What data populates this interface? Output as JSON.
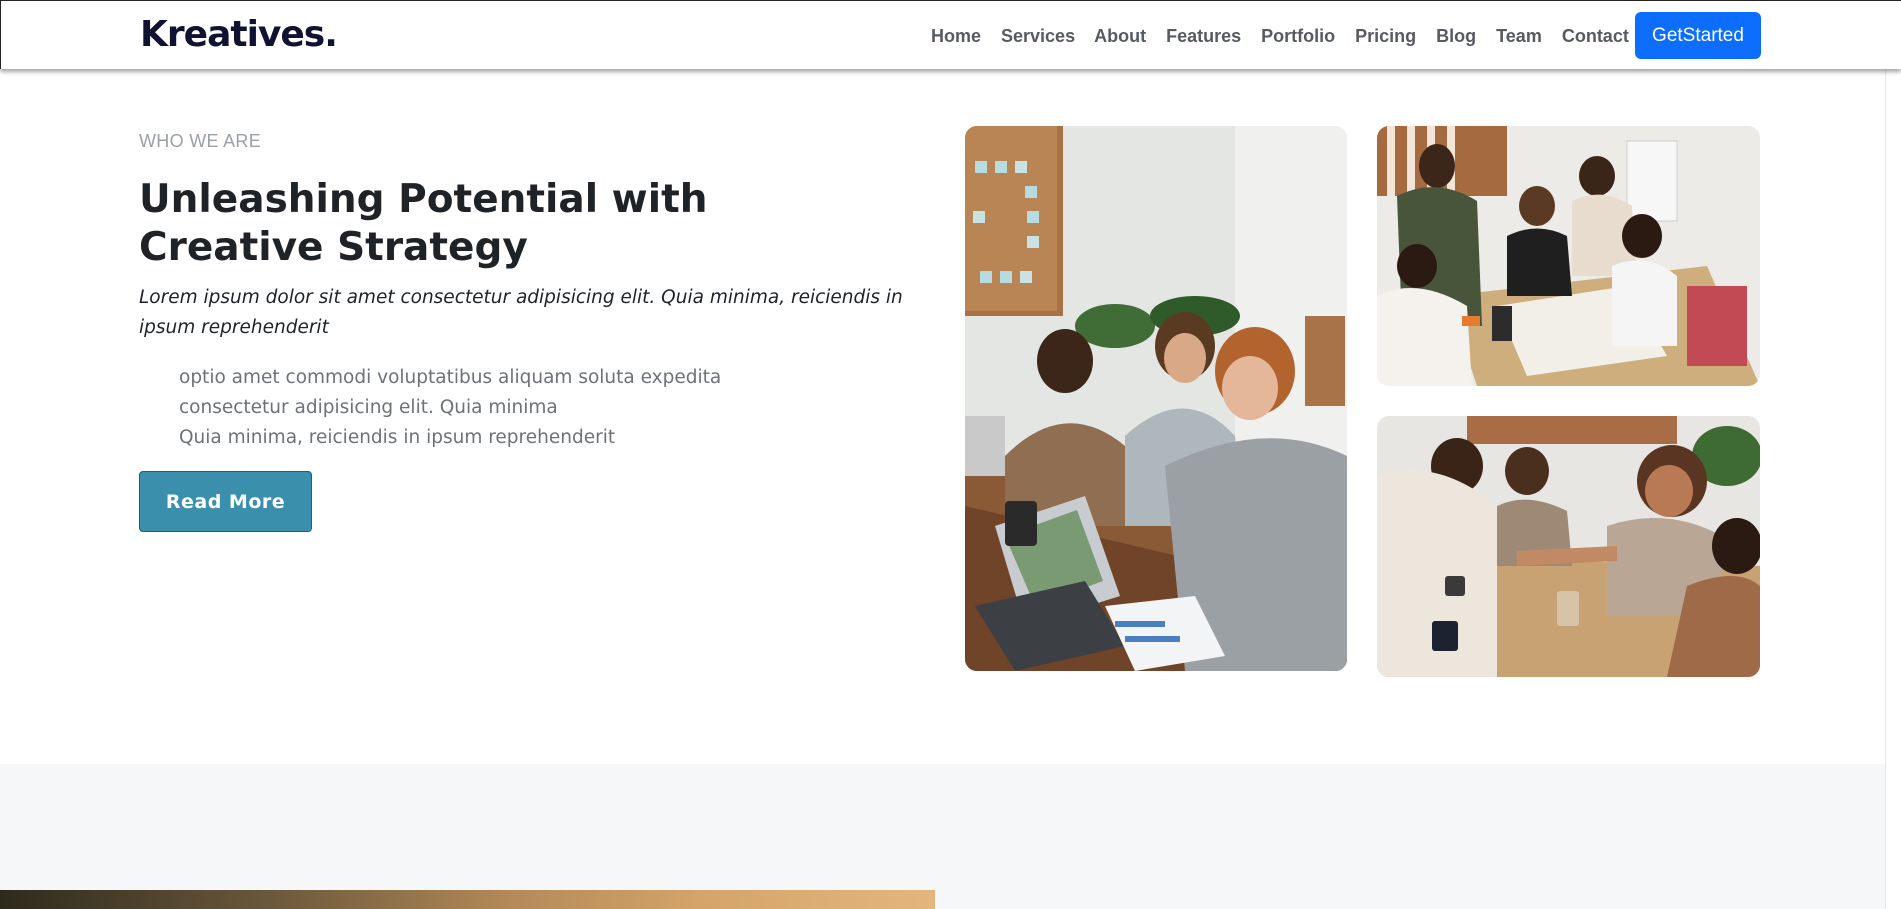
{
  "brand": {
    "logo": "Kreatives."
  },
  "nav": {
    "items": [
      "Home",
      "Services",
      "About",
      "Features",
      "Portfolio",
      "Pricing",
      "Blog",
      "Team",
      "Contact"
    ],
    "cta_label": "GetStarted"
  },
  "hero": {
    "eyebrow": "WHO WE ARE",
    "title": "Unleashing Potential with Creative Strategy",
    "lead": "Lorem ipsum dolor sit amet consectetur adipisicing elit. Quia minima, reiciendis in ipsum reprehenderit",
    "features": [
      "optio amet commodi voluptatibus aliquam soluta expedita",
      "consectetur adipisicing elit. Quia minima",
      "Quia minima, reiciendis in ipsum reprehenderit"
    ],
    "button_label": "Read More"
  },
  "colors": {
    "brand_text": "#0f1331",
    "cta_blue": "#0d6efd",
    "read_more": "#3a8fad",
    "section_bg": "#f6f7f9"
  }
}
